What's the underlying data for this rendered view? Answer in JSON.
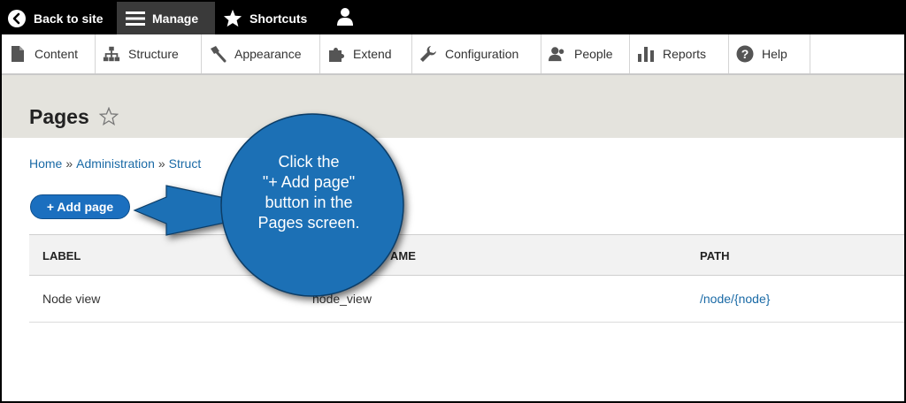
{
  "toolbar": {
    "back_label": "Back to site",
    "manage_label": "Manage",
    "shortcuts_label": "Shortcuts",
    "icons": [
      "back-arrow-icon",
      "hamburger-menu-icon",
      "star-icon",
      "user-icon"
    ]
  },
  "menu": {
    "items": [
      {
        "label": "Content",
        "icon": "content-page-icon"
      },
      {
        "label": "Structure",
        "icon": "structure-icon"
      },
      {
        "label": "Appearance",
        "icon": "paintbrush-icon"
      },
      {
        "label": "Extend",
        "icon": "puzzle-icon"
      },
      {
        "label": "Configuration",
        "icon": "wrench-icon"
      },
      {
        "label": "People",
        "icon": "people-icon"
      },
      {
        "label": "Reports",
        "icon": "bar-chart-icon"
      },
      {
        "label": "Help",
        "icon": "help-icon"
      }
    ]
  },
  "page": {
    "title": "Pages",
    "breadcrumb": [
      "Home",
      "Administration",
      "Struct"
    ],
    "add_button_label": "+ Add page"
  },
  "table": {
    "headers": [
      "LABEL",
      "AME",
      "PATH"
    ],
    "rows": [
      {
        "label": "Node view",
        "name": "node_view",
        "path_prefix": "/node/",
        "path_param": "{node}"
      }
    ]
  },
  "callout": {
    "lines": [
      "Click the",
      "\"+ Add page\"",
      "button in the",
      "Pages screen."
    ],
    "color": "#1b6fb5"
  },
  "colors": {
    "link": "#1a6aa6",
    "button": "#1b6fbf",
    "header_band": "#e4e3dd"
  }
}
